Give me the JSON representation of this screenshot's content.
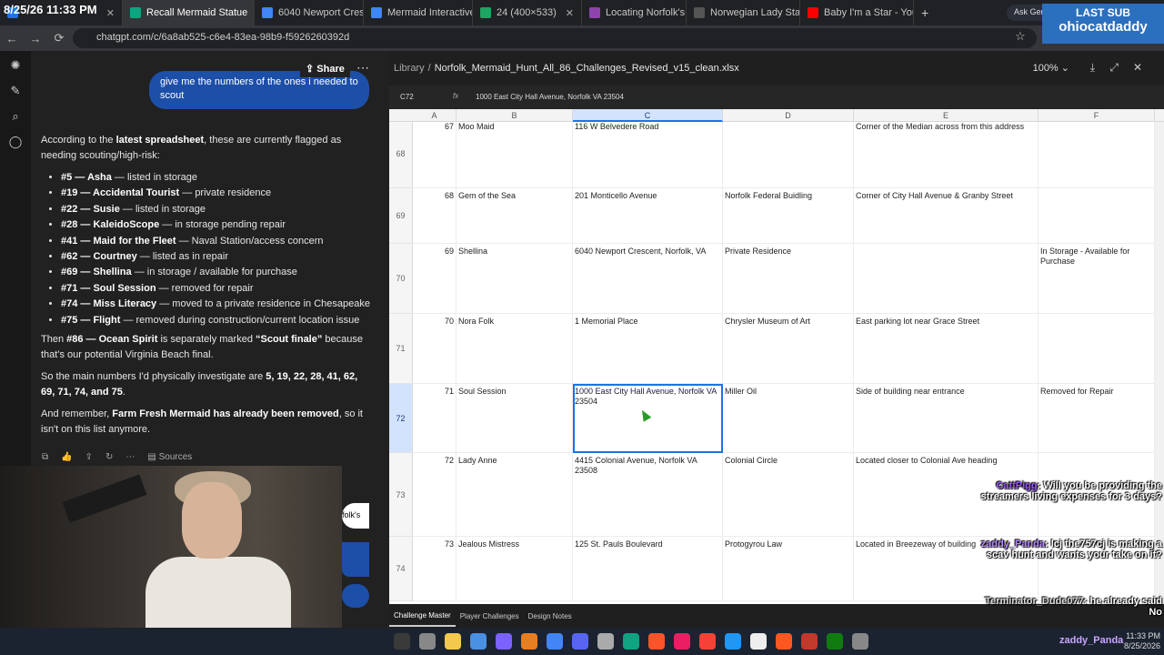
{
  "clock": "8/25/26 11:33 PM",
  "tabs": [
    {
      "label": "",
      "color": "#1a73e8",
      "active": false,
      "icon": "tab-icon"
    },
    {
      "label": "Recall Mermaid Statue",
      "color": "#10a37f",
      "active": true,
      "icon": "chatgpt-icon"
    },
    {
      "label": "6040 Newport Crescen",
      "color": "#4285f4",
      "active": false,
      "icon": "maps-icon"
    },
    {
      "label": "Mermaid Interactive Sp",
      "color": "#4285f4",
      "active": false,
      "icon": "doc-icon"
    },
    {
      "label": "24 (400×533)",
      "color": "#1fa463",
      "active": false,
      "icon": "image-icon"
    },
    {
      "label": "Locating Norfolk's Bay",
      "color": "#8e44ad",
      "active": false,
      "icon": "gemini-icon"
    },
    {
      "label": "Norwegian Lady Statue",
      "color": "#555555",
      "active": false,
      "icon": "web-icon"
    },
    {
      "label": "Baby I'm a Star - YouT",
      "color": "#ff0000",
      "active": false,
      "icon": "youtube-icon"
    }
  ],
  "ask_gemini": "Ask Gemini",
  "url": "chatgpt.com/c/6a8ab525-c6e4-83ea-98b9-f5926260392d",
  "last_sub": {
    "title": "LAST SUB",
    "name": "ohiocatdaddy"
  },
  "chat": {
    "share": "Share",
    "user_message": "give me the numbers of the ones i needed to scout",
    "intro_pre": "According to the ",
    "intro_bold": "latest spreadsheet",
    "intro_post": ", these are currently flagged as needing scouting/high-risk:",
    "items": [
      {
        "bold": "#5 — Asha",
        "text": " — listed in storage"
      },
      {
        "bold": "#19 — Accidental Tourist",
        "text": " — private residence"
      },
      {
        "bold": "#22 — Susie",
        "text": " — listed in storage"
      },
      {
        "bold": "#28 — KaleidoScope",
        "text": " — in storage pending repair"
      },
      {
        "bold": "#41 — Maid for the Fleet",
        "text": " — Naval Station/access concern"
      },
      {
        "bold": "#62 — Courtney",
        "text": " — listed as in repair"
      },
      {
        "bold": "#69 — Shellina",
        "text": " — in storage / available for purchase"
      },
      {
        "bold": "#71 — Soul Session",
        "text": " — removed for repair"
      },
      {
        "bold": "#74 — Miss Literacy",
        "text": " — moved to a private residence in Chesapeake"
      },
      {
        "bold": "#75 — Flight",
        "text": " — removed during construction/current location issue"
      }
    ],
    "p2_pre": "Then ",
    "p2_bold": "#86 — Ocean Spirit",
    "p2_mid": " is separately marked ",
    "p2_bold2": "“Scout finale”",
    "p2_post": " because that's our potential Virginia Beach final.",
    "p3_pre": "So the main numbers I'd physically investigate are ",
    "p3_bold": "5, 19, 22, 28, 41, 62, 69, 71, 74, and 75",
    "p3_post": ".",
    "p4_pre": "And remember, ",
    "p4_bold": "Farm Fresh Mermaid has already been removed",
    "p4_post": ", so it isn't on this list anymore.",
    "sources": "Sources",
    "popup_label": "folk's"
  },
  "sheet": {
    "library": "Library",
    "separator": "/",
    "filename": "Norfolk_Mermaid_Hunt_All_86_Challenges_Revised_v15_clean.xlsx",
    "zoom": "100%",
    "cell_ref": "C72",
    "fx": "fx",
    "formula_value": "1000 East City Hall Avenue, Norfolk VA 23504",
    "columns": [
      "A",
      "B",
      "C",
      "D",
      "E",
      "F"
    ],
    "rows": [
      {
        "rn": "68",
        "num": "67",
        "name": "Moo Maid",
        "addr": "116 W Belvedere Road",
        "d": "",
        "e": "Corner of the Median across from this address",
        "f": ""
      },
      {
        "rn": "69",
        "num": "68",
        "name": "Gem of the Sea",
        "addr": "201 Monticello Avenue",
        "d": "Norfolk Federal Buidling",
        "e": "Corner of City Hall Avenue & Granby Street",
        "f": ""
      },
      {
        "rn": "70",
        "num": "69",
        "name": "Shellina",
        "addr": "6040 Newport Crescent, Norfolk, VA",
        "d": "Private Residence",
        "e": "",
        "f": "In Storage - Available for Purchase"
      },
      {
        "rn": "71",
        "num": "70",
        "name": "Nora Folk",
        "addr": "1 Memorial Place",
        "d": "Chrysler Museum of Art",
        "e": "East parking lot near Grace Street",
        "f": ""
      },
      {
        "rn": "72",
        "num": "71",
        "name": "Soul Session",
        "addr": "1000 East City Hall Avenue, Norfolk VA 23504",
        "d": "Miller Oil",
        "e": "Side of building near entrance",
        "f": "Removed for Repair"
      },
      {
        "rn": "73",
        "num": "72",
        "name": "Lady Anne",
        "addr": "4415 Colonial Avenue, Norfolk  VA 23508",
        "d": "Colonial Circle",
        "e": "Located closer to Colonial Ave heading",
        "f": ""
      },
      {
        "rn": "74",
        "num": "73",
        "name": "Jealous Mistress",
        "addr": "125 St. Pauls Boulevard",
        "d": "Protogyrou Law",
        "e": "Located in Breezeway of building",
        "f": ""
      }
    ],
    "sheet_tabs": [
      "Challenge Master",
      "Player Challenges",
      "Design Notes"
    ]
  },
  "stream_chat": [
    {
      "user": "CattPigg",
      "text": ": Will you be providing the streamers living expenses for 3 days?"
    },
    {
      "user": "zaddy_Panda",
      "text": ": lcj the757cj is making a scav hunt and wants your take on it?"
    },
    {
      "user": "Terminator_Dude077",
      "text": ": he already said No"
    }
  ],
  "tray": {
    "time": "11:33 PM",
    "date": "8/25/2026"
  },
  "tray_user": "zaddy_Panda"
}
